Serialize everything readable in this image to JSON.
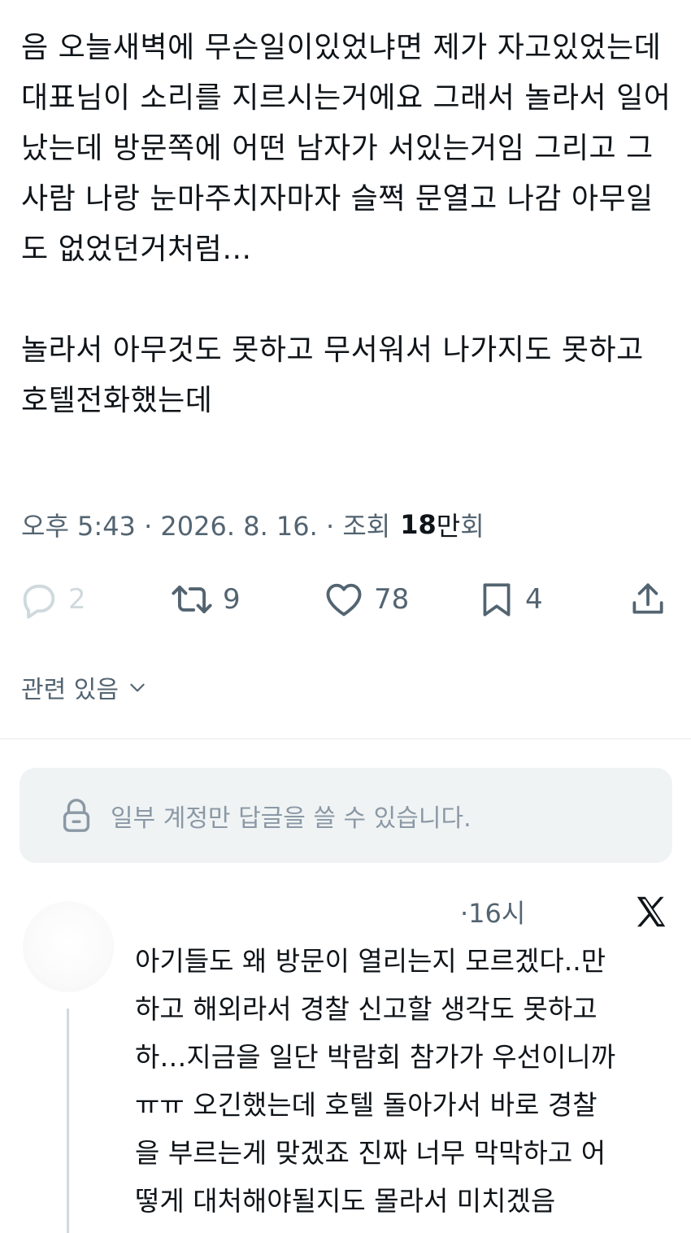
{
  "post": {
    "text": "음 오늘새벽에 무슨일이있었냐면 제가 자고있었는데 대표님이 소리를 지르시는거에요 그래서 놀라서 일어났는데 방문쪽에 어떤 남자가 서있는거임 그리고 그사람 나랑 눈마주치자마자 슬쩍 문열고 나감 아무일도 없었던거처럼…\n\n놀라서 아무것도 못하고 무서워서 나가지도 못하고 호텔전화했는데",
    "timestamp": "오후 5:43 · 2026. 8. 16. · 조회",
    "views_number": "18",
    "views_unit": "만",
    "views_suffix": "회"
  },
  "actions": {
    "reply_count": "2",
    "retweet_count": "9",
    "like_count": "78",
    "bookmark_count": "4"
  },
  "related": {
    "label": "관련 있음"
  },
  "reply_restriction": {
    "text": "일부 계정만 답글을 쓸 수 있습니다."
  },
  "reply": {
    "time": "·16시",
    "text": "아기들도 왜 방문이 열리는지 모르겠다..만\n하고 해외라서 경찰 신고할 생각도 못하고\n하…지금을 일단 박람회 참가가 우선이니까\nㅠㅠ 오긴했는데 호텔 돌아가서 바로 경찰\n을 부르는게 맞겠죠 진짜 너무 막막하고 어\n떻게 대처해야될지도 몰라서 미치겠음\n해코지 안당해서 다행인가 싶기도하고"
  },
  "colors": {
    "text_primary": "#0f1419",
    "text_secondary": "#536471",
    "notice_bg": "#eff3f4"
  }
}
